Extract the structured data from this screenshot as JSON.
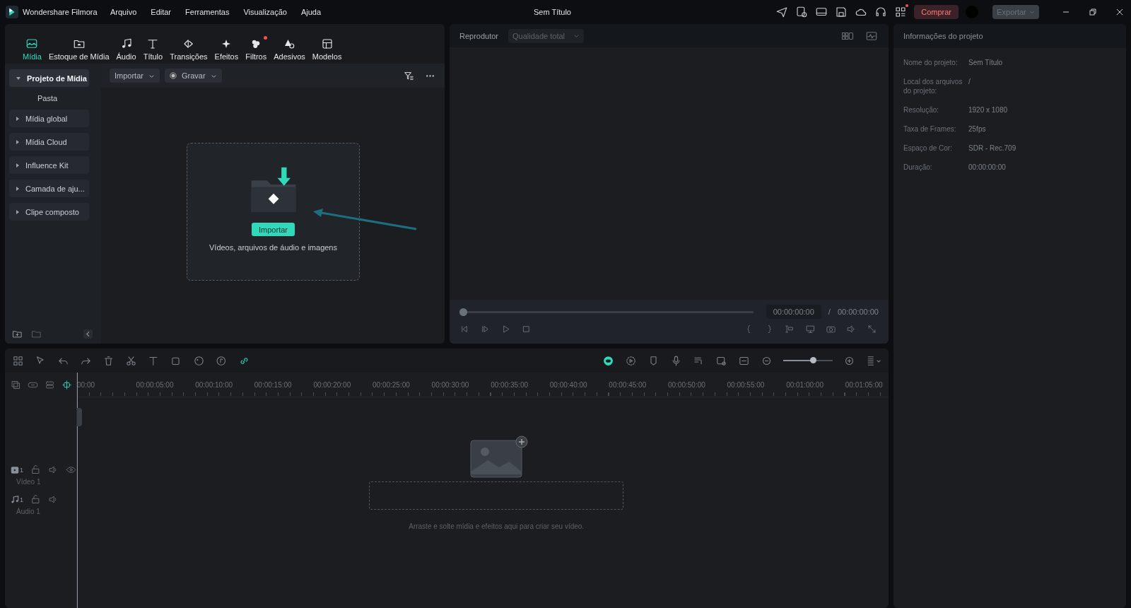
{
  "app": {
    "name": "Wondershare Filmora",
    "title": "Sem Título"
  },
  "menu": [
    "Arquivo",
    "Editar",
    "Ferramentas",
    "Visualização",
    "Ajuda"
  ],
  "header": {
    "buy": "Comprar",
    "export": {
      "label": "Exportar",
      "disabled": true
    }
  },
  "tabs": [
    {
      "label": "Mídia",
      "selected": true,
      "dot": false
    },
    {
      "label": "Estoque de Mídia",
      "selected": false,
      "dot": false
    },
    {
      "label": "Áudio",
      "selected": false,
      "dot": false
    },
    {
      "label": "Título",
      "selected": false,
      "dot": false
    },
    {
      "label": "Transições",
      "selected": false,
      "dot": false
    },
    {
      "label": "Efeitos",
      "selected": false,
      "dot": false
    },
    {
      "label": "Filtros",
      "selected": false,
      "dot": true
    },
    {
      "label": "Adesivos",
      "selected": false,
      "dot": false
    },
    {
      "label": "Modelos",
      "selected": false,
      "dot": false
    }
  ],
  "sidebar": {
    "items": [
      {
        "label": "Projeto de Mídia",
        "selected": true,
        "expanded": true,
        "children": [
          {
            "label": "Pasta",
            "selected": false
          }
        ]
      },
      {
        "label": "Mídia global",
        "selected": false,
        "expanded": false
      },
      {
        "label": "Mídia Cloud",
        "selected": false,
        "expanded": false
      },
      {
        "label": "Influence Kit",
        "selected": false,
        "expanded": false
      },
      {
        "label": "Camada de aju...",
        "selected": false,
        "expanded": false
      },
      {
        "label": "Clipe composto",
        "selected": false,
        "expanded": false
      }
    ]
  },
  "media_toolbar": {
    "import": "Importar",
    "record": "Gravar"
  },
  "dropzone": {
    "button": "Importar",
    "hint": "Vídeos, arquivos de áudio e imagens"
  },
  "player": {
    "label": "Reprodutor",
    "quality": "Qualidade total",
    "level": 0,
    "current": "00:00:00:00",
    "separator": "/",
    "total": "00:00:00:00"
  },
  "project_info": {
    "title": "Informações do projeto",
    "rows": [
      {
        "label": "Nome do projeto:",
        "value": "Sem Título"
      },
      {
        "label": "Local dos arquivos do projeto:",
        "value": "/"
      },
      {
        "label": "Resolução:",
        "value": "1920 x 1080"
      },
      {
        "label": "Taxa de Frames:",
        "value": "25fps"
      },
      {
        "label": "Espaço de Cor:",
        "value": "SDR - Rec.709"
      },
      {
        "label": "Duração:",
        "value": "00:00:00:00"
      }
    ]
  },
  "timeline": {
    "zoom": {
      "level": 0.62
    },
    "ruler": [
      "00:00",
      "00:00:05:00",
      "00:00:10:00",
      "00:00:15:00",
      "00:00:20:00",
      "00:00:25:00",
      "00:00:30:00",
      "00:00:35:00",
      "00:00:40:00",
      "00:00:45:00",
      "00:00:50:00",
      "00:00:55:00",
      "00:01:00:00",
      "00:01:05:00"
    ],
    "tracks": [
      {
        "kind": "video",
        "count": "1",
        "name": "Vídeo 1"
      },
      {
        "kind": "audio",
        "count": "1",
        "name": "Áudio 1"
      }
    ],
    "drop_hint": "Arraste e solte mídia e efeitos aqui para criar seu vídeo."
  }
}
